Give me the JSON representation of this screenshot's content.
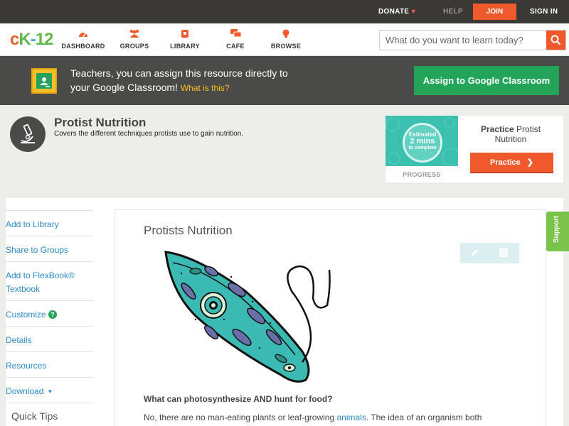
{
  "topbar": {
    "donate": "DONATE",
    "donate_icon": "heart-icon",
    "help": "HELP",
    "join": "JOIN",
    "signin": "SIGN IN"
  },
  "logo": {
    "c": "c",
    "k": "K",
    "dash": "-",
    "num": "12"
  },
  "nav": {
    "items": [
      {
        "label": "DASHBOARD",
        "icon": "dashboard-gauge-icon"
      },
      {
        "label": "GROUPS",
        "icon": "groups-people-icon"
      },
      {
        "label": "LIBRARY",
        "icon": "library-book-icon"
      },
      {
        "label": "CAFE",
        "icon": "cafe-chat-icon"
      },
      {
        "label": "BROWSE",
        "icon": "browse-bulb-icon"
      }
    ],
    "search_placeholder": "What do you want to learn today?"
  },
  "banner": {
    "line1": "Teachers, you can assign this resource directly to",
    "line2": "your Google Classroom!",
    "what": "What is this?",
    "assign_button": "Assign to Google Classroom"
  },
  "header": {
    "title": "Protist Nutrition",
    "subtitle": "Covers the different techniques protists use to gain nutrition."
  },
  "practice": {
    "estimated": "Estimated",
    "minutes": "2 mins",
    "to_complete": "to complete",
    "progress_label": "PROGRESS",
    "card_bold": "Practice",
    "card_text": "Protist Nutrition",
    "button": "Practice"
  },
  "sidebar": {
    "items": [
      {
        "label": "Add to Library"
      },
      {
        "label": "Share to Groups"
      },
      {
        "label": "Add to FlexBook®"
      },
      {
        "label": "Textbook"
      },
      {
        "label": "Customize"
      },
      {
        "label": "Details"
      },
      {
        "label": "Resources"
      },
      {
        "label": "Download"
      }
    ],
    "quick_tips": "Quick Tips"
  },
  "content": {
    "title": "Protists Nutrition",
    "question": "What can photosynthesize AND hunt for food?",
    "para_start": "No, there are no man-eating plants or leaf-growing ",
    "para_link": "animals",
    "para_end": ". The idea of an organism both"
  },
  "support": "Support",
  "colors": {
    "accent": "#f0592b",
    "green": "#22a459",
    "link": "#2c8ac7",
    "banner": "#4a4a48"
  }
}
